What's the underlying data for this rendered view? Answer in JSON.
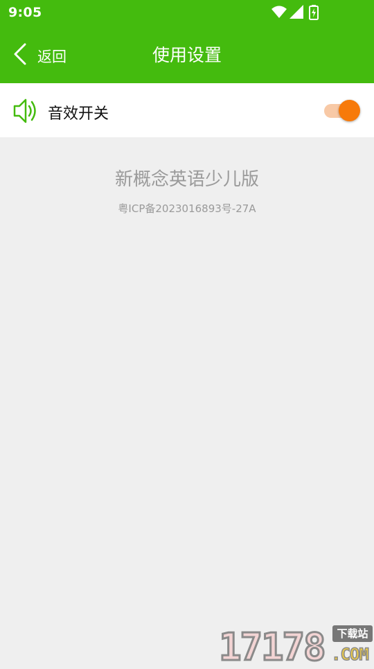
{
  "status_bar": {
    "time": "9:05",
    "icons": [
      "wifi-icon",
      "cellular-signal-icon",
      "battery-charging-icon"
    ]
  },
  "app_bar": {
    "back_label": "返回",
    "title": "使用设置",
    "background_color": "#44bb0e"
  },
  "settings": {
    "sound_effects": {
      "label": "音效开关",
      "icon": "speaker-icon",
      "enabled": true,
      "toggle_color": "#f77a0a"
    }
  },
  "about": {
    "app_name": "新概念英语少儿版",
    "icp": "粤ICP备2023016893号-27A"
  },
  "watermark": {
    "number": "17178",
    "tag": "下载站",
    "suffix": ".COM"
  }
}
